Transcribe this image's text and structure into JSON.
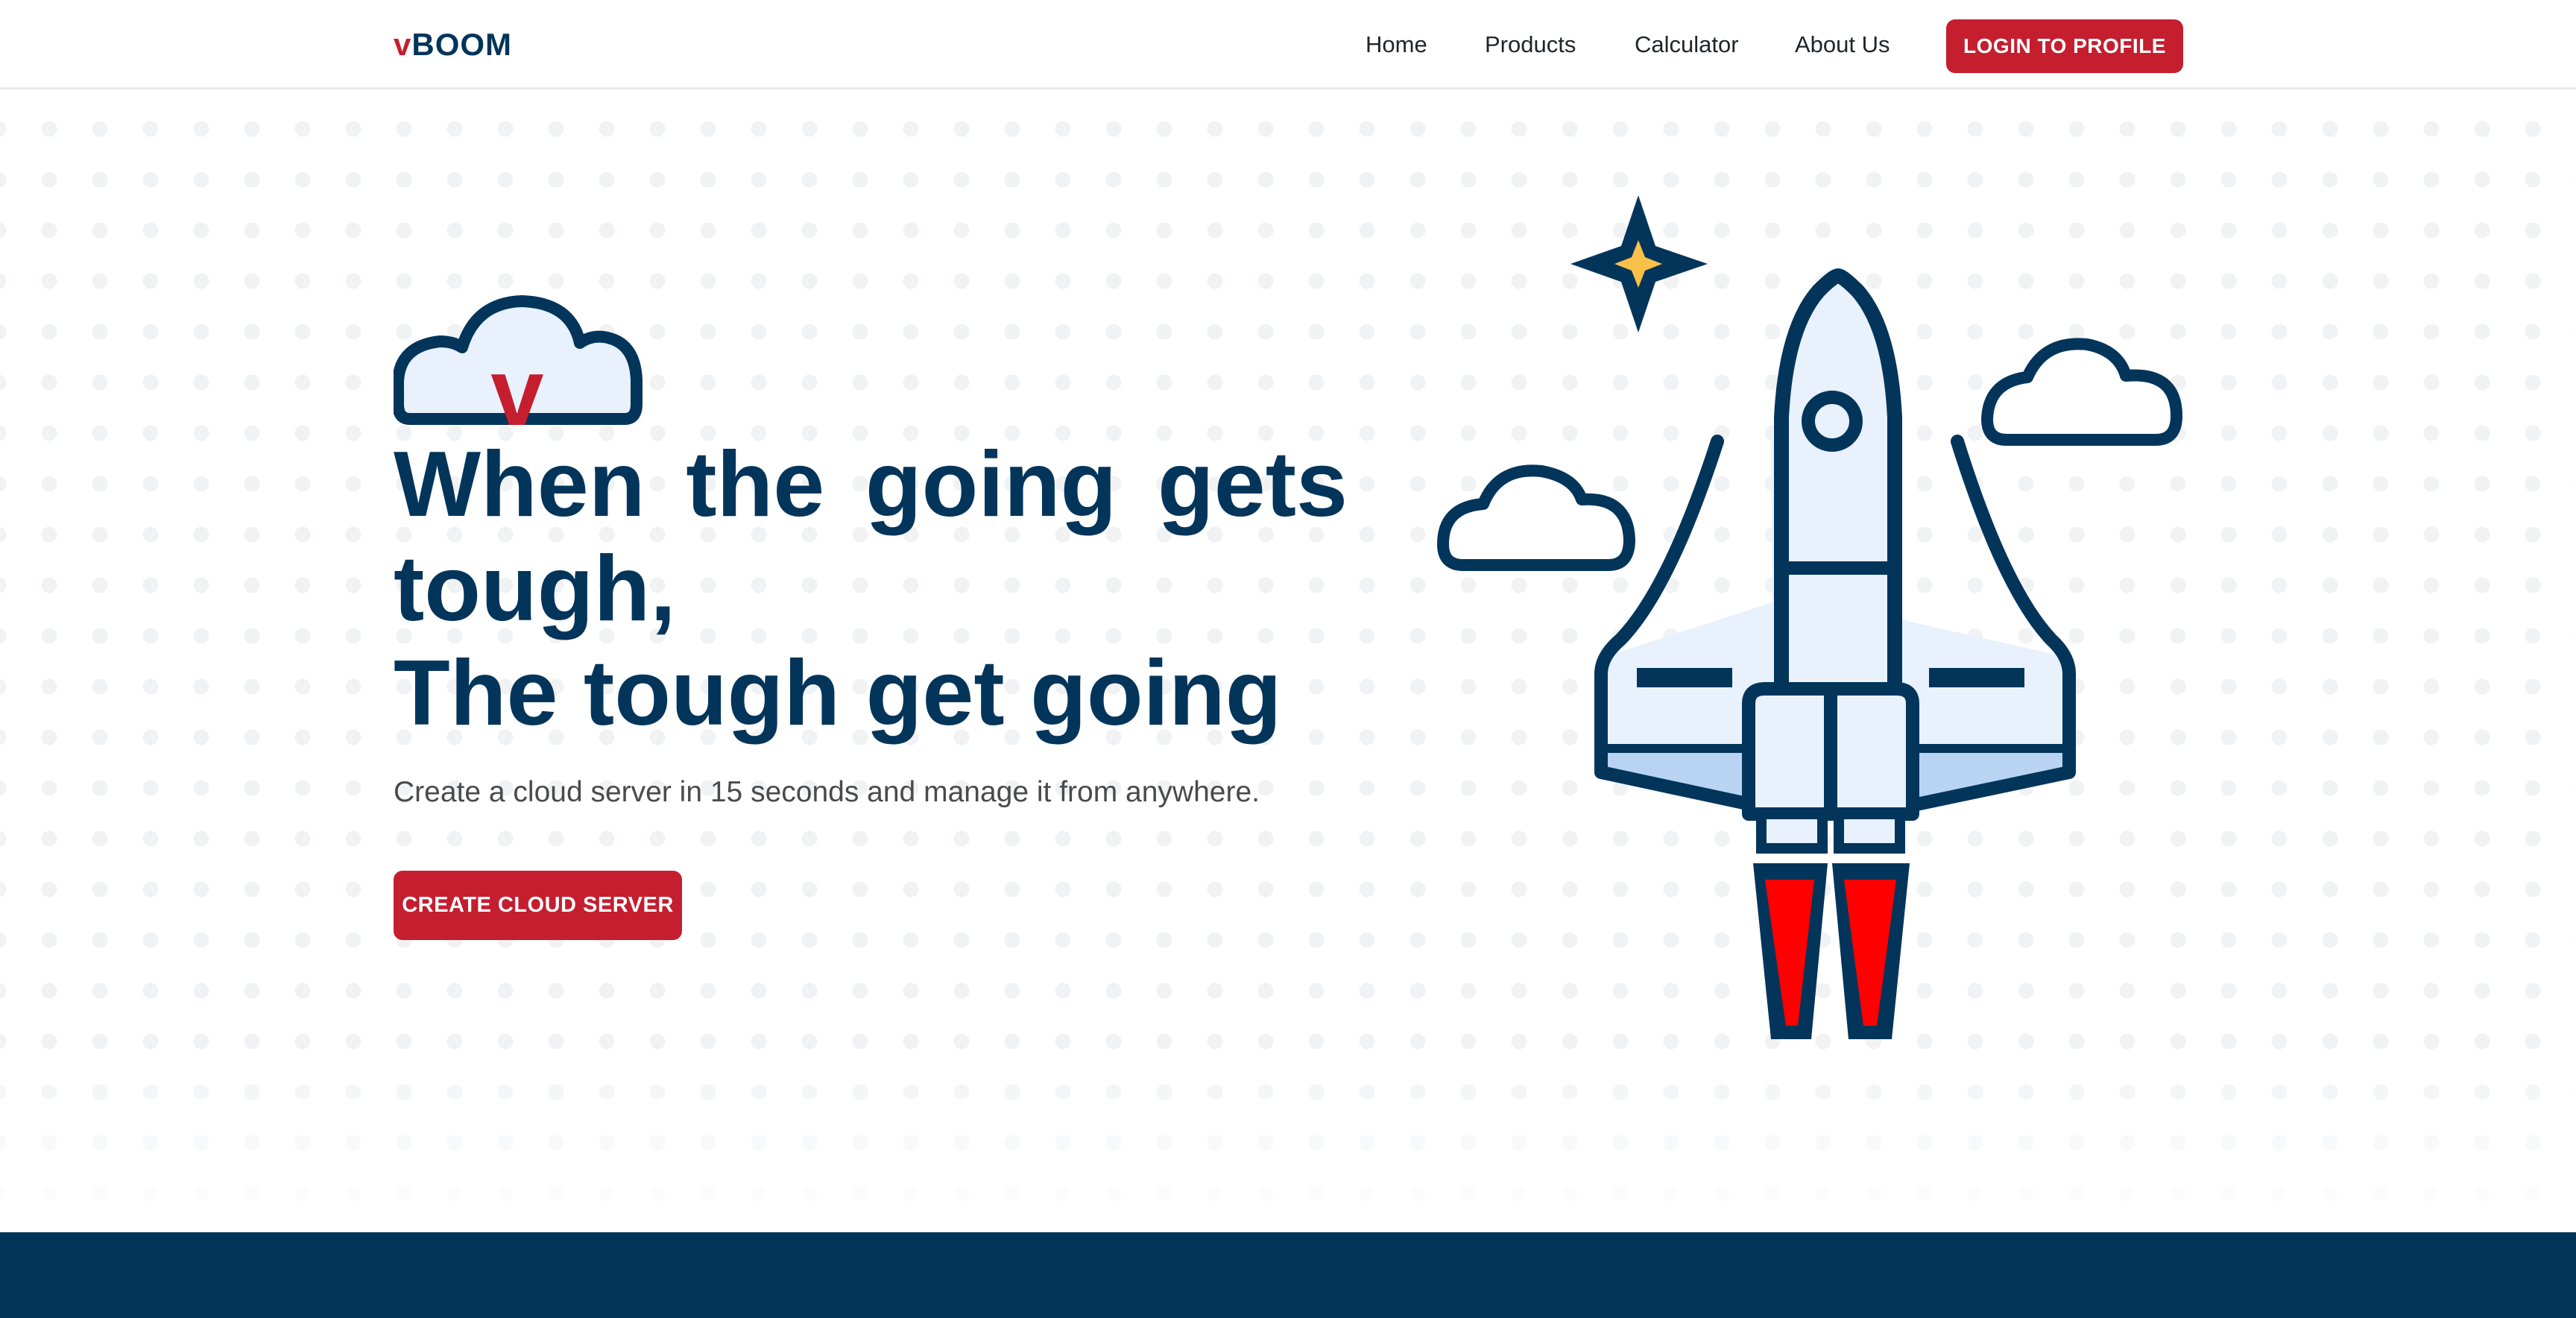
{
  "brand": {
    "prefix": "v",
    "name": "BOOM"
  },
  "nav": {
    "home": "Home",
    "products": "Products",
    "calculator": "Calculator",
    "about": "About Us"
  },
  "login_button": "LOGIN TO PROFILE",
  "hero": {
    "line1": "When the going gets",
    "line2": "tough,",
    "line3": "The tough get going",
    "subtitle": "Create a cloud server in 15 seconds and manage it from anywhere.",
    "cta": "CREATE CLOUD SERVER",
    "icon_letter": "v"
  },
  "colors": {
    "brand_navy": "#03355b",
    "brand_red": "#c41e2f",
    "flame_red": "#ff0000",
    "star_gold": "#f9c04a",
    "rocket_fill": "#e8f1fc",
    "rocket_shade": "#b8d4f2"
  },
  "icons": [
    "cloud-v-logo-icon",
    "rocket-icon",
    "star-icon",
    "cloud-icon"
  ]
}
